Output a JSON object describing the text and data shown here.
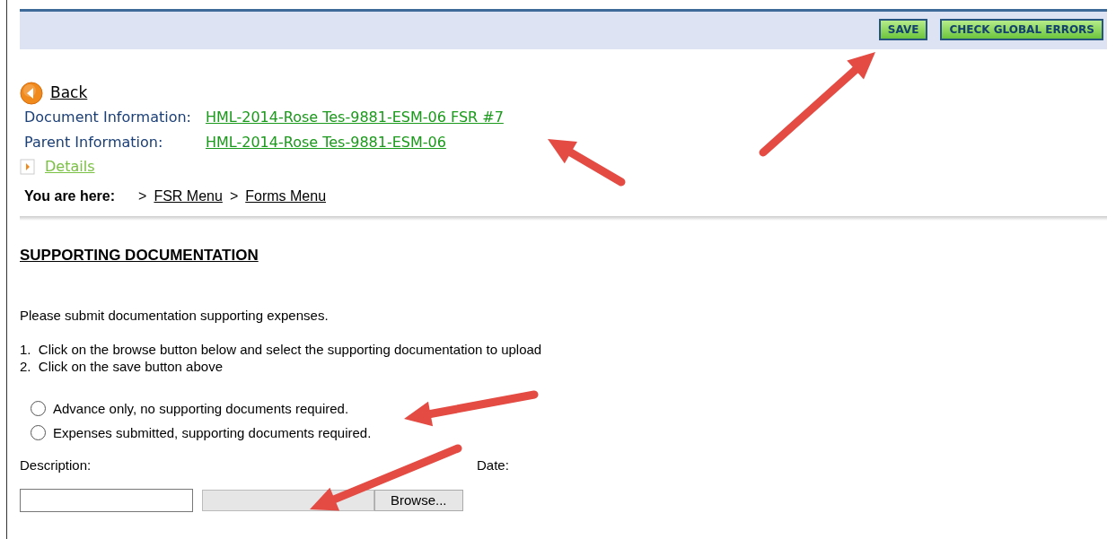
{
  "header": {
    "buttons": [
      {
        "label": "SAVE"
      },
      {
        "label": "CHECK GLOBAL ERRORS"
      }
    ]
  },
  "back_link": "Back",
  "document_information": {
    "label": "Document Information:",
    "link": "HML-2014-Rose Tes-9881-ESM-06 FSR #7"
  },
  "parent_information": {
    "label": "Parent Information:",
    "link": "HML-2014-Rose Tes-9881-ESM-06"
  },
  "details": {
    "label": "Details",
    "expanded": false
  },
  "breadcrumb": {
    "label": "You are here:",
    "items": [
      {
        "separator": ">",
        "label": "FSR Menu"
      },
      {
        "separator": ">",
        "label": "Forms Menu"
      }
    ]
  },
  "section": {
    "heading": "SUPPORTING DOCUMENTATION",
    "intro": "Please submit documentation supporting expenses.",
    "steps": [
      {
        "number": "1.",
        "text": "Click on the browse button below and select the supporting documentation to upload"
      },
      {
        "number": "2.",
        "text": "Click on the save button above"
      }
    ]
  },
  "radios": [
    {
      "label": "Advance only, no supporting documents required.",
      "selected": false
    },
    {
      "label": "Expenses submitted, supporting documents required.",
      "selected": false
    }
  ],
  "description": {
    "label": "Description:"
  },
  "date": {
    "label": "Date:"
  },
  "file": {
    "button": "Browse..."
  }
}
